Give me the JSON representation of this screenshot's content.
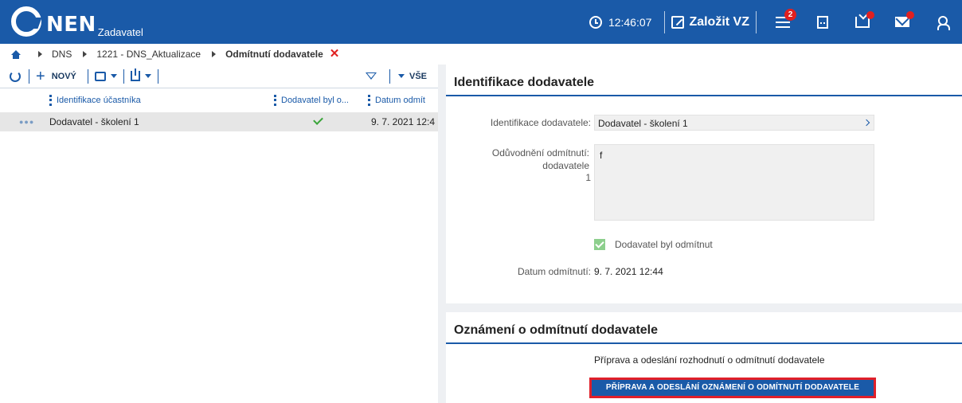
{
  "header": {
    "logo_name": "NEN",
    "logo_sub": "Zadavatel",
    "time": "12:46:07",
    "create_label": "Založit VZ",
    "menu_badge": "2"
  },
  "breadcrumb": {
    "items": [
      "DNS",
      "1221 - DNS_Aktualizace",
      "Odmítnutí dodavatele"
    ]
  },
  "toolbar": {
    "new_label": "NOVÝ",
    "all_label": "VŠE"
  },
  "grid": {
    "columns": [
      "Identifikace účastníka",
      "Dodavatel byl o...",
      "Datum odmít"
    ],
    "rows": [
      {
        "name": "Dodavatel - školení 1",
        "rejected": true,
        "date": "9. 7. 2021 12:4"
      }
    ]
  },
  "detail": {
    "section_title": "Identifikace dodavatele",
    "id_label": "Identifikace dodavatele:",
    "id_value": "Dodavatel - školení 1",
    "reason_label": "Odůvodnění odmítnutí: dodavatele",
    "reason_count": "1",
    "reason_value": "f",
    "rejected_label": "Dodavatel byl odmítnut",
    "date_label": "Datum odmítnutí:",
    "date_value": "9. 7. 2021 12:44"
  },
  "notice": {
    "section_title": "Oznámení o odmítnutí dodavatele",
    "text": "Příprava a odeslání rozhodnutí o odmítnutí dodavatele",
    "button_label": "PŘÍPRAVA A ODESLÁNÍ OZNÁMENÍ O ODMÍTNUTÍ DODAVATELE"
  },
  "colors": {
    "brand": "#1a5aa8",
    "alert": "#e02020",
    "success": "#3aa53a"
  }
}
